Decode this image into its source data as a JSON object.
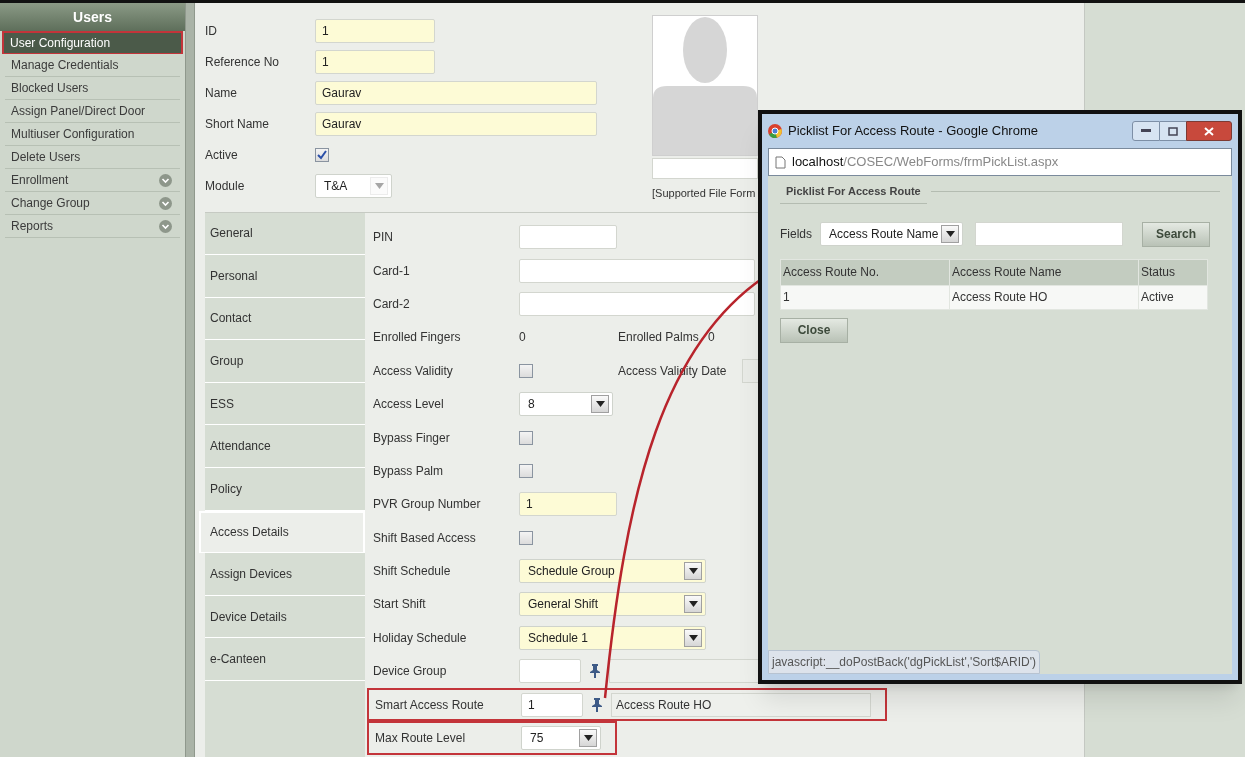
{
  "sidebar": {
    "title": "Users",
    "items": [
      {
        "label": "User Configuration",
        "selected": true,
        "highlighted": true,
        "expandable": false
      },
      {
        "label": "Manage Credentials",
        "selected": false,
        "highlighted": false,
        "expandable": false
      },
      {
        "label": "Blocked Users",
        "selected": false,
        "highlighted": false,
        "expandable": false
      },
      {
        "label": "Assign Panel/Direct Door",
        "selected": false,
        "highlighted": false,
        "expandable": false
      },
      {
        "label": "Multiuser Configuration",
        "selected": false,
        "highlighted": false,
        "expandable": false
      },
      {
        "label": "Delete Users",
        "selected": false,
        "highlighted": false,
        "expandable": false
      },
      {
        "label": "Enrollment",
        "selected": false,
        "highlighted": false,
        "expandable": true
      },
      {
        "label": "Change Group",
        "selected": false,
        "highlighted": false,
        "expandable": true
      },
      {
        "label": "Reports",
        "selected": false,
        "highlighted": false,
        "expandable": true
      }
    ]
  },
  "header_fields": [
    {
      "kind": "text",
      "label": "ID",
      "value": "1",
      "required": true
    },
    {
      "kind": "text",
      "label": "Reference No",
      "value": "1",
      "required": true
    },
    {
      "kind": "text",
      "label": "Name",
      "value": "Gaurav",
      "required": true
    },
    {
      "kind": "text",
      "label": "Short Name",
      "value": "Gaurav",
      "required": true
    },
    {
      "kind": "check",
      "label": "Active",
      "checked": true
    },
    {
      "kind": "select",
      "label": "Module",
      "value": "T&A",
      "disabled": true
    }
  ],
  "photo": {
    "caption": "[Supported File Form"
  },
  "tabs": [
    {
      "label": "General",
      "selected": false,
      "highlighted": false
    },
    {
      "label": "Personal",
      "selected": false,
      "highlighted": false
    },
    {
      "label": "Contact",
      "selected": false,
      "highlighted": false
    },
    {
      "label": "Group",
      "selected": false,
      "highlighted": false
    },
    {
      "label": "ESS",
      "selected": false,
      "highlighted": false
    },
    {
      "label": "Attendance",
      "selected": false,
      "highlighted": false
    },
    {
      "label": "Policy",
      "selected": false,
      "highlighted": false
    },
    {
      "label": "Access Details",
      "selected": true,
      "highlighted": true
    },
    {
      "label": "Assign Devices",
      "selected": false,
      "highlighted": false
    },
    {
      "label": "Device Details",
      "selected": false,
      "highlighted": false
    },
    {
      "label": "e-Canteen",
      "selected": false,
      "highlighted": false
    }
  ],
  "details": [
    {
      "kind": "text",
      "label": "PIN",
      "required": false,
      "highlighted": false
    },
    {
      "kind": "text",
      "label": "Card-1",
      "required": false,
      "highlighted": false
    },
    {
      "kind": "text",
      "label": "Card-2",
      "required": false,
      "highlighted": false
    },
    {
      "kind": "counts",
      "label": "Enrolled Fingers",
      "value": "0",
      "label2": "Enrolled Palms",
      "value2": "0",
      "highlighted": false
    },
    {
      "kind": "check",
      "label": "Access Validity",
      "checked": false,
      "label2": "Access Validity Date",
      "highlighted": false
    },
    {
      "kind": "select",
      "label": "Access Level",
      "value": "8",
      "required": false,
      "highlighted": false
    },
    {
      "kind": "check",
      "label": "Bypass Finger",
      "checked": false,
      "highlighted": false
    },
    {
      "kind": "check",
      "label": "Bypass Palm",
      "checked": false,
      "highlighted": false
    },
    {
      "kind": "text",
      "label": "PVR Group Number",
      "value": "1",
      "required": true,
      "highlighted": false
    },
    {
      "kind": "check",
      "label": "Shift Based Access",
      "checked": false,
      "highlighted": false
    },
    {
      "kind": "select",
      "label": "Shift Schedule",
      "value": "Schedule Group",
      "required": true,
      "highlighted": false
    },
    {
      "kind": "select",
      "label": "Start Shift",
      "value": "General Shift",
      "required": true,
      "highlighted": false
    },
    {
      "kind": "select",
      "label": "Holiday Schedule",
      "value": "Schedule 1",
      "required": true,
      "highlighted": false
    },
    {
      "kind": "lookup",
      "label": "Device Group",
      "highlighted": false
    },
    {
      "kind": "lookup",
      "label": "Smart Access Route",
      "value": "1",
      "name": "Access Route HO",
      "highlighted": true
    },
    {
      "kind": "select",
      "label": "Max Route Level",
      "value": "75",
      "required": false,
      "highlighted": true
    }
  ],
  "popup": {
    "title": "Picklist For Access Route - Google Chrome",
    "url_host": "localhost",
    "url_path": "/COSEC/WebForms/frmPickList.aspx",
    "legend": "Picklist For Access Route",
    "fields_label": "Fields",
    "fields_value": "Access Route Name",
    "search_button": "Search",
    "columns": [
      "Access Route No.",
      "Access Route Name",
      "Status"
    ],
    "rows": [
      [
        "1",
        "Access Route HO",
        "Active"
      ]
    ],
    "close_button": "Close",
    "status_text": "javascript:__doPostBack('dgPickList','Sort$ARID')"
  }
}
